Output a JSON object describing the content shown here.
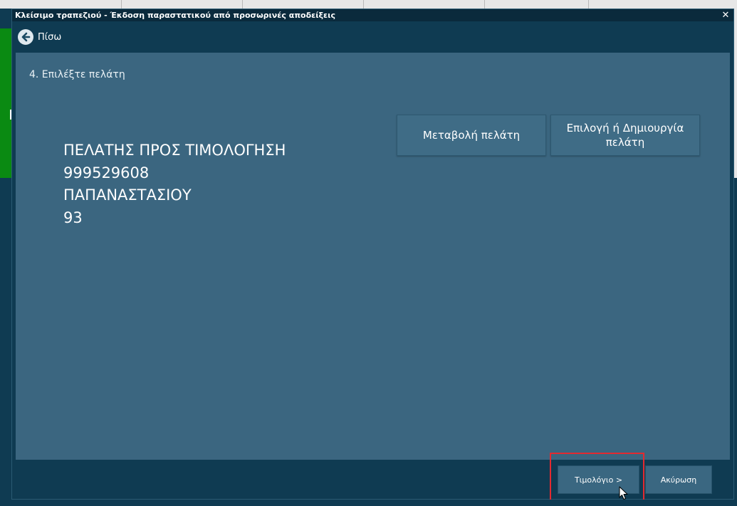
{
  "window": {
    "title": "Κλείσιμο τραπεζιού - Έκδοση παραστατικού από προσωρινές αποδείξεις",
    "close_glyph": "✕"
  },
  "nav": {
    "back_label": "Πίσω"
  },
  "step": {
    "label": "4. Επιλέξτε πελάτη"
  },
  "customer": {
    "name": "ΠΕΛΑΤΗΣ ΠΡΟΣ ΤΙΜΟΛΟΓΗΣΗ",
    "tax_id": "999529608",
    "street": "ΠΑΠΑΝΑΣΤΑΣΙΟΥ",
    "number": "93"
  },
  "actions": {
    "change_customer": "Μεταβολή πελάτη",
    "select_or_create_customer": "Επιλογή ή Δημιουργία πελάτη"
  },
  "footer": {
    "invoice_label": "Τιμολόγιο >",
    "cancel_label": "Ακύρωση"
  },
  "icons": {
    "back": "arrow-left-circle-icon",
    "close": "close-icon",
    "cursor": "mouse-pointer-icon"
  },
  "colors": {
    "panel": "#3b6680",
    "frame": "#0f3b52",
    "titlebar": "#0a2a3c",
    "highlight": "#e32a30",
    "green_bar": "#0a8a12"
  }
}
